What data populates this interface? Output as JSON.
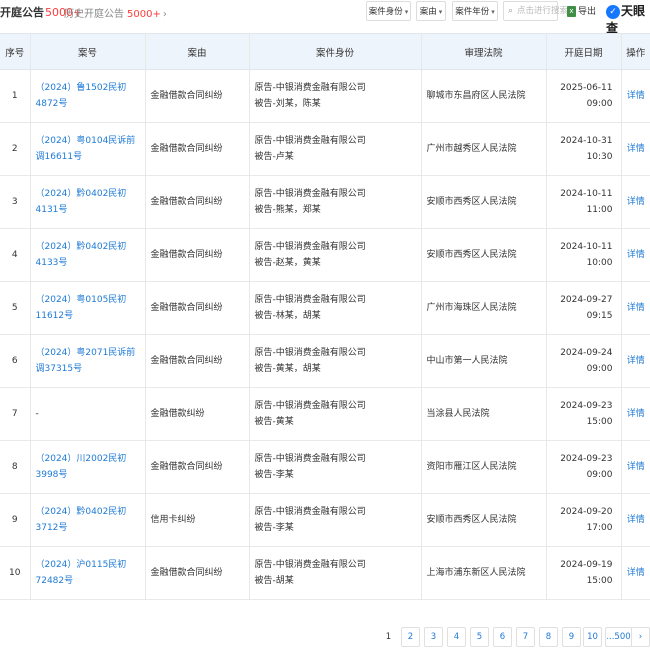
{
  "header": {
    "title": "开庭公告",
    "title_count": "5000+",
    "history_label": "历史开庭公告",
    "history_count": "5000+",
    "history_chevron": "›",
    "filters": [
      {
        "label": "案件身份"
      },
      {
        "label": "案由"
      },
      {
        "label": "案件年份"
      }
    ],
    "search_placeholder": "点击进行搜索",
    "export_label": "导出",
    "logo_text": "天眼查"
  },
  "table": {
    "columns": [
      "序号",
      "案号",
      "案由",
      "案件身份",
      "审理法院",
      "开庭日期",
      "操作"
    ],
    "rows": [
      {
        "no": "1",
        "case": "（2024）鲁1502民初4872号",
        "cause": "金融借款合同纠纷",
        "plaintiff": "原告-中银消费金融有限公司",
        "defendant": "被告-刘某，陈某",
        "court": "聊城市东昌府区人民法院",
        "date": "2025-06-11 09:00",
        "action": "详情"
      },
      {
        "no": "2",
        "case": "（2024）粤0104民诉前调16611号",
        "cause": "金融借款合同纠纷",
        "plaintiff": "原告-中银消费金融有限公司",
        "defendant": "被告-卢某",
        "court": "广州市越秀区人民法院",
        "date": "2024-10-31 10:30",
        "action": "详情"
      },
      {
        "no": "3",
        "case": "（2024）黔0402民初4131号",
        "cause": "金融借款合同纠纷",
        "plaintiff": "原告-中银消费金融有限公司",
        "defendant": "被告-熊某，郑某",
        "court": "安顺市西秀区人民法院",
        "date": "2024-10-11 11:00",
        "action": "详情"
      },
      {
        "no": "4",
        "case": "（2024）黔0402民初4133号",
        "cause": "金融借款合同纠纷",
        "plaintiff": "原告-中银消费金融有限公司",
        "defendant": "被告-赵某，黄某",
        "court": "安顺市西秀区人民法院",
        "date": "2024-10-11 10:00",
        "action": "详情"
      },
      {
        "no": "5",
        "case": "（2024）粤0105民初11612号",
        "cause": "金融借款合同纠纷",
        "plaintiff": "原告-中银消费金融有限公司",
        "defendant": "被告-林某，胡某",
        "court": "广州市海珠区人民法院",
        "date": "2024-09-27 09:15",
        "action": "详情"
      },
      {
        "no": "6",
        "case": "（2024）粤2071民诉前调37315号",
        "cause": "金融借款合同纠纷",
        "plaintiff": "原告-中银消费金融有限公司",
        "defendant": "被告-黄某，胡某",
        "court": "中山市第一人民法院",
        "date": "2024-09-24 09:00",
        "action": "详情"
      },
      {
        "no": "7",
        "case": "-",
        "cause": "金融借款纠纷",
        "plaintiff": "原告-中银消费金融有限公司",
        "defendant": "被告-黄某",
        "court": "当涂县人民法院",
        "date": "2024-09-23 15:00",
        "action": "详情"
      },
      {
        "no": "8",
        "case": "（2024）川2002民初3998号",
        "cause": "金融借款合同纠纷",
        "plaintiff": "原告-中银消费金融有限公司",
        "defendant": "被告-李某",
        "court": "资阳市雁江区人民法院",
        "date": "2024-09-23 09:00",
        "action": "详情"
      },
      {
        "no": "9",
        "case": "（2024）黔0402民初3712号",
        "cause": "信用卡纠纷",
        "plaintiff": "原告-中银消费金融有限公司",
        "defendant": "被告-李某",
        "court": "安顺市西秀区人民法院",
        "date": "2024-09-20 17:00",
        "action": "详情"
      },
      {
        "no": "10",
        "case": "（2024）沪0115民初72482号",
        "cause": "金融借款合同纠纷",
        "plaintiff": "原告-中银消费金融有限公司",
        "defendant": "被告-胡某",
        "court": "上海市浦东新区人民法院",
        "date": "2024-09-19 15:00",
        "action": "详情"
      }
    ]
  },
  "pagination": {
    "current": "1",
    "pages": [
      "2",
      "3",
      "4",
      "5",
      "6",
      "7",
      "8",
      "9",
      "10"
    ],
    "last": "...500",
    "next": "›"
  }
}
